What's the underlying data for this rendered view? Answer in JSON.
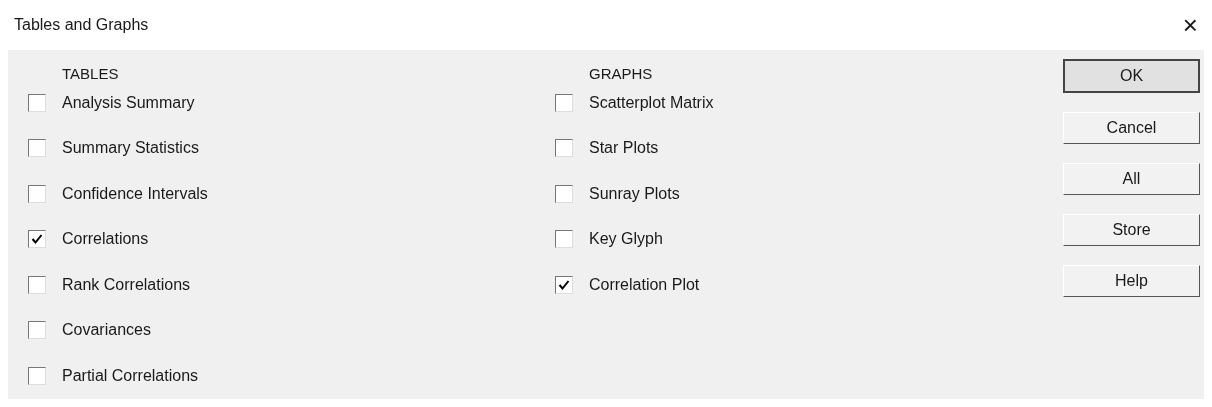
{
  "window": {
    "title": "Tables and Graphs",
    "close": "×"
  },
  "tables": {
    "heading": "TABLES",
    "items": [
      {
        "label": "Analysis Summary",
        "checked": false
      },
      {
        "label": "Summary Statistics",
        "checked": false
      },
      {
        "label": "Confidence Intervals",
        "checked": false
      },
      {
        "label": "Correlations",
        "checked": true
      },
      {
        "label": "Rank Correlations",
        "checked": false
      },
      {
        "label": "Covariances",
        "checked": false
      },
      {
        "label": "Partial Correlations",
        "checked": false
      }
    ]
  },
  "graphs": {
    "heading": "GRAPHS",
    "items": [
      {
        "label": "Scatterplot Matrix",
        "checked": false
      },
      {
        "label": "Star Plots",
        "checked": false
      },
      {
        "label": "Sunray Plots",
        "checked": false
      },
      {
        "label": "Key Glyph",
        "checked": false
      },
      {
        "label": "Correlation Plot",
        "checked": true
      }
    ]
  },
  "buttons": [
    {
      "label": "OK",
      "default": true
    },
    {
      "label": "Cancel",
      "default": false
    },
    {
      "label": "All",
      "default": false
    },
    {
      "label": "Store",
      "default": false
    },
    {
      "label": "Help",
      "default": false
    }
  ]
}
